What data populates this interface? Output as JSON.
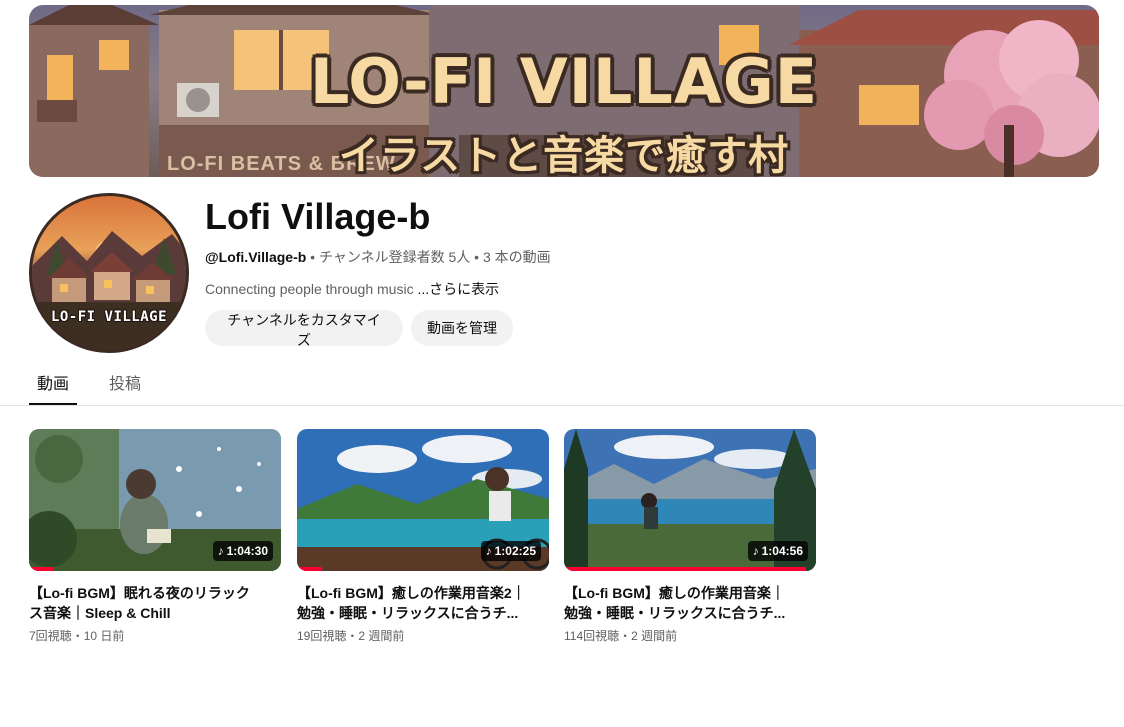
{
  "banner": {
    "title": "LO-FI VILLAGE",
    "subtitle": "イラストと音楽で癒す村",
    "sign": "LO-FI BEATS & BREW"
  },
  "avatar": {
    "label": "LO-FI VILLAGE"
  },
  "channel": {
    "name": "Lofi Village-b",
    "handle": "@Lofi.Village-b",
    "separator": " • ",
    "subscribers": "チャンネル登録者数 5人",
    "video_count": "3 本の動画",
    "description": "Connecting people through music ",
    "more": "...さらに表示"
  },
  "actions": {
    "customize": "チャンネルをカスタマイズ",
    "manage": "動画を管理"
  },
  "tabs": [
    {
      "label": "動画",
      "selected": true
    },
    {
      "label": "投稿",
      "selected": false
    }
  ],
  "videos": [
    {
      "title": "【Lo-fi BGM】眠れる夜のリラックス音楽｜Sleep & Chill",
      "duration": "1:04:30",
      "views": "7回視聴",
      "age": "10 日前",
      "watched_fraction": 0.1
    },
    {
      "title": "【Lo-fi BGM】癒しの作業用音楽2｜勉強・睡眠・リラックスに合うチ...",
      "duration": "1:02:25",
      "views": "19回視聴",
      "age": "2 週間前",
      "watched_fraction": 0.1
    },
    {
      "title": "【Lo-fi BGM】癒しの作業用音楽｜勉強・睡眠・リラックスに合うチ...",
      "duration": "1:04:56",
      "views": "114回視聴",
      "age": "2 週間前",
      "watched_fraction": 0.96
    }
  ],
  "meta_separator": "・",
  "colors": {
    "progress": "#ff0033",
    "button_bg": "#f2f2f2",
    "secondary_text": "#606060"
  }
}
